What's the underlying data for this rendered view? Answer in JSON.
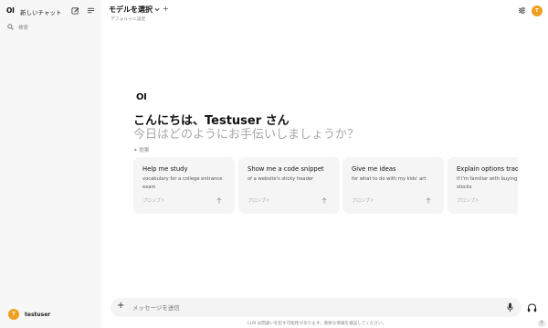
{
  "sidebar": {
    "logo": "OI",
    "new_chat": "新しいチャット",
    "search_label": "検索",
    "user_initial": "T",
    "username": "testuser"
  },
  "header": {
    "model_select": "モデルを選択",
    "add_model": "+",
    "default_setting": "デフォルトに設定",
    "avatar_initial": "T"
  },
  "welcome": {
    "logo": "OI",
    "greeting": "こんにちは、Testuser さん",
    "subtitle": "今日はどのようにお手伝いしましょうか？",
    "suggested_label": "提案"
  },
  "suggestions": [
    {
      "title": "Help me study",
      "desc": "vocabulary for a college entrance exam",
      "foot": "プロンプト"
    },
    {
      "title": "Show me a code snippet",
      "desc": "of a website's sticky header",
      "foot": "プロンプト"
    },
    {
      "title": "Give me ideas",
      "desc": "for what to do with my kids' art",
      "foot": "プロンプト"
    },
    {
      "title": "Explain options trading",
      "desc": "if I'm familiar with buying and selling stocks",
      "foot": "プロンプト"
    }
  ],
  "composer": {
    "placeholder": "メッセージを送信",
    "add": "+"
  },
  "footer": {
    "disclaimer": "LLM は間違いを犯す可能性があります。重要な情報を検証してください。",
    "help": "?"
  },
  "colors": {
    "accent_avatar": "#f0a020",
    "sidebar_bg": "#f7f7f7",
    "card_bg": "#f5f5f5"
  }
}
